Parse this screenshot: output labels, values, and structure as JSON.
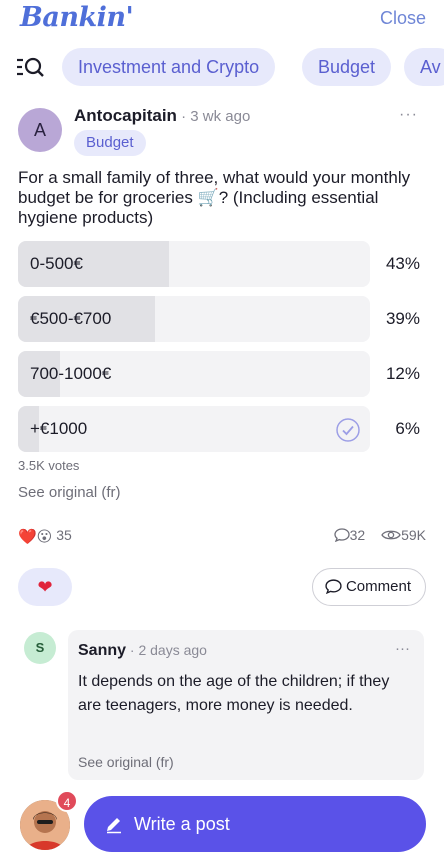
{
  "app": {
    "brand": "Bankin'",
    "close_label": "Close"
  },
  "tabs": {
    "items": [
      "Investment and Crypto",
      "Budget",
      "Av"
    ]
  },
  "post": {
    "avatar_initial": "A",
    "author": "Antocapitain",
    "separator": " · ",
    "time": "3 wk ago",
    "more": "···",
    "tag": "Budget",
    "question": "For a small family of three, what would your monthly budget be for groceries 🛒? (Including essential hygiene products)"
  },
  "poll": {
    "options": [
      {
        "label": "0-500€",
        "percent": "43%",
        "fill": 0.43
      },
      {
        "label": "€500-€700",
        "percent": "39%",
        "fill": 0.39
      },
      {
        "label": "700-1000€",
        "percent": "12%",
        "fill": 0.12
      },
      {
        "label": "+€1000",
        "percent": "6%",
        "fill": 0.06
      }
    ],
    "votes": "3.5K votes",
    "see_original": "See original (fr)"
  },
  "engagement": {
    "reaction_emojis": "❤️😮",
    "reaction_count": "35",
    "comment_count": "32",
    "view_count": "59K",
    "like_icon": "❤",
    "comment_button_label": "Comment"
  },
  "comment": {
    "avatar_initial": "S",
    "author": "Sanny",
    "separator": " · ",
    "time": "2 days ago",
    "more": "···",
    "text": "It depends on the age of the children; if they are teenagers, more money is needed.",
    "see_original": "See original (fr)"
  },
  "bottom": {
    "badge": "4",
    "write_label": "Write a post"
  },
  "colors": {
    "accent": "#5a52e8",
    "chip_bg": "#e7e9fb",
    "heart": "#e0243b"
  }
}
